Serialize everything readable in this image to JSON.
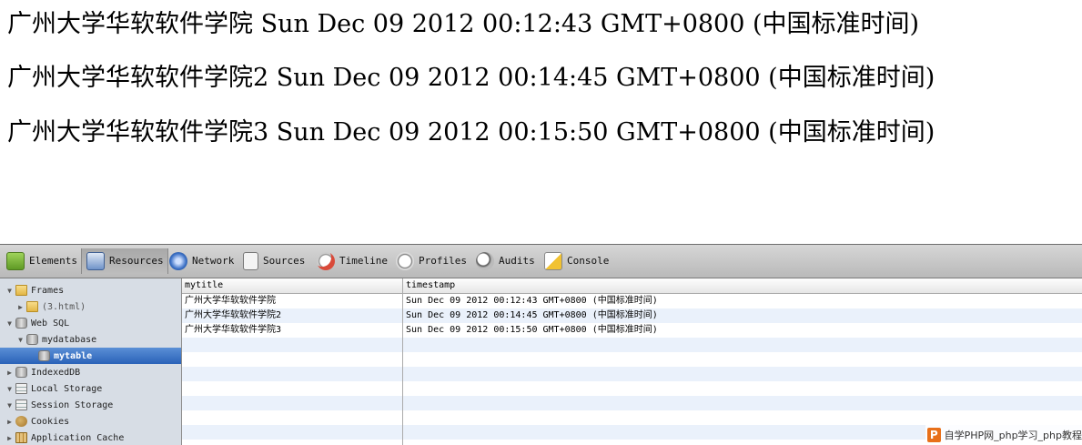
{
  "content": {
    "lines": [
      "广州大学华软软件学院 Sun Dec 09 2012 00:12:43 GMT+0800 (中国标准时间)",
      "广州大学华软软件学院2 Sun Dec 09 2012 00:14:45 GMT+0800 (中国标准时间)",
      "广州大学华软软件学院3 Sun Dec 09 2012 00:15:50 GMT+0800 (中国标准时间)"
    ]
  },
  "toolbar": {
    "tabs": [
      {
        "label": "Elements",
        "icon": "elements-icon",
        "color": "#7bb33a"
      },
      {
        "label": "Resources",
        "icon": "resources-icon",
        "color": "#5d86c8",
        "selected": true
      },
      {
        "label": "Network",
        "icon": "network-icon",
        "color": "#3a6fc4"
      },
      {
        "label": "Sources",
        "icon": "sources-icon",
        "color": "#e5e5e5"
      },
      {
        "label": "Timeline",
        "icon": "timeline-icon",
        "color": "#d94a3a"
      },
      {
        "label": "Profiles",
        "icon": "profiles-icon",
        "color": "#c9c9c9"
      },
      {
        "label": "Audits",
        "icon": "audits-icon",
        "color": "#9c9c9c"
      },
      {
        "label": "Console",
        "icon": "console-icon",
        "color": "#f1c232"
      }
    ]
  },
  "sidebar": {
    "items": [
      {
        "label": "Frames",
        "expand": "▼",
        "icon": "folder-icon",
        "level": 0
      },
      {
        "label": "(3.html)",
        "expand": "▶",
        "icon": "folder-icon",
        "level": 1
      },
      {
        "label": "Web SQL",
        "expand": "▼",
        "icon": "database-icon",
        "level": 0
      },
      {
        "label": "mydatabase",
        "expand": "▼",
        "icon": "database-icon",
        "level": 1
      },
      {
        "label": "mytable",
        "expand": "",
        "icon": "database-icon",
        "level": 2,
        "selected": true
      },
      {
        "label": "IndexedDB",
        "expand": "▶",
        "icon": "database-icon",
        "level": 0
      },
      {
        "label": "Local Storage",
        "expand": "▼",
        "icon": "table-icon",
        "level": 0
      },
      {
        "label": "Session Storage",
        "expand": "▼",
        "icon": "table-icon",
        "level": 0
      },
      {
        "label": "Cookies",
        "expand": "▶",
        "icon": "cookie-icon",
        "level": 0
      },
      {
        "label": "Application Cache",
        "expand": "▶",
        "icon": "cache-icon",
        "level": 0
      }
    ]
  },
  "grid": {
    "columns": [
      "mytitle",
      "timestamp"
    ],
    "rows": [
      [
        "广州大学华软软件学院",
        "Sun Dec 09 2012 00:12:43 GMT+0800 (中国标准时间)"
      ],
      [
        "广州大学华软软件学院2",
        "Sun Dec 09 2012 00:14:45 GMT+0800 (中国标准时间)"
      ],
      [
        "广州大学华软软件学院3",
        "Sun Dec 09 2012 00:15:50 GMT+0800 (中国标准时间)"
      ]
    ],
    "selected_color": "#2a62b8",
    "alt_row_color": "#eaf1fb"
  },
  "watermark": {
    "logo": "P",
    "text": "自学PHP网_php学习_php教程"
  }
}
